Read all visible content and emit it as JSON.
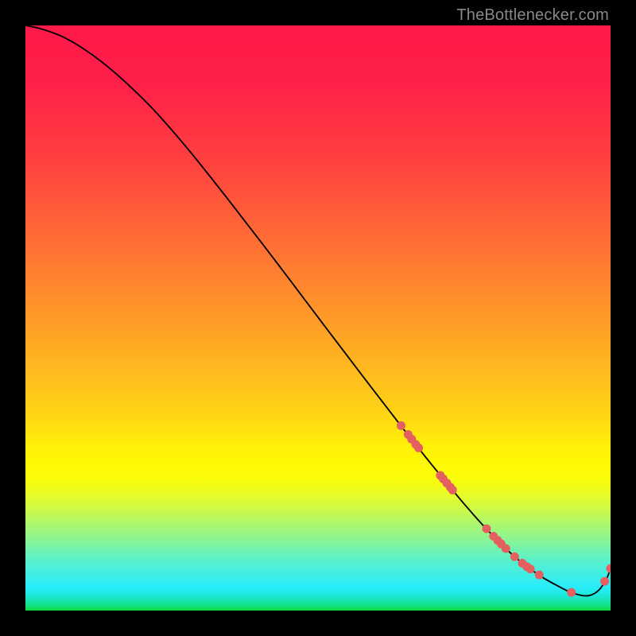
{
  "signature": "TheBottlenecker.com",
  "chart_data": {
    "type": "line",
    "xlabel": "",
    "ylabel": "",
    "xlim": [
      0,
      100
    ],
    "ylim": [
      0,
      100
    ],
    "gradient_stops": [
      {
        "pct": 0,
        "color": "#ff1a49"
      },
      {
        "pct": 9,
        "color": "#ff1e49"
      },
      {
        "pct": 24,
        "color": "#ff433f"
      },
      {
        "pct": 39,
        "color": "#ff7433"
      },
      {
        "pct": 54,
        "color": "#ffa824"
      },
      {
        "pct": 66,
        "color": "#ffd316"
      },
      {
        "pct": 72,
        "color": "#fff108"
      },
      {
        "pct": 76,
        "color": "#fffb04"
      },
      {
        "pct": 78.5,
        "color": "#f5fc13"
      },
      {
        "pct": 82,
        "color": "#d5fa3e"
      },
      {
        "pct": 88,
        "color": "#89f497"
      },
      {
        "pct": 92,
        "color": "#53f0d3"
      },
      {
        "pct": 96,
        "color": "#28ecf9"
      },
      {
        "pct": 97.5,
        "color": "#1be8d9"
      },
      {
        "pct": 99,
        "color": "#13e18b"
      },
      {
        "pct": 100,
        "color": "#0fda41"
      }
    ],
    "series": [
      {
        "name": "curve",
        "color": "#000000",
        "show_markers": false,
        "x": [
          0.0,
          2.0,
          4.0,
          6.5,
          9.5,
          13.0,
          17.0,
          22.0,
          28.0,
          35.0,
          43.0,
          51.0,
          58.0,
          64.0,
          68.5,
          72.0,
          75.0,
          78.0,
          81.0,
          83.5,
          86.0,
          88.5,
          91.0,
          93.0,
          95.0,
          96.5,
          98.0,
          99.3,
          100.0
        ],
        "y": [
          100.0,
          99.6,
          99.0,
          98.0,
          96.3,
          93.8,
          90.4,
          85.5,
          78.6,
          69.8,
          59.4,
          48.8,
          39.6,
          31.8,
          26.1,
          21.8,
          18.2,
          14.8,
          11.7,
          9.3,
          7.3,
          5.6,
          4.2,
          3.2,
          2.6,
          2.6,
          3.5,
          5.4,
          7.2
        ]
      },
      {
        "name": "markers",
        "color": "#e46060",
        "show_markers": true,
        "marker_radius_px": 5.5,
        "x": [
          64.2,
          65.4,
          66.0,
          66.7,
          67.2,
          70.9,
          71.4,
          72.0,
          72.6,
          73.0,
          78.8,
          80.0,
          80.7,
          81.3,
          82.1,
          83.6,
          84.9,
          85.7,
          86.3,
          87.8,
          93.3,
          99.0,
          100.0
        ],
        "y": [
          31.6,
          30.1,
          29.3,
          28.4,
          27.8,
          23.1,
          22.5,
          21.8,
          21.1,
          20.6,
          14.0,
          12.7,
          12.0,
          11.4,
          10.6,
          9.2,
          8.1,
          7.5,
          7.1,
          6.1,
          3.1,
          5.0,
          7.2
        ]
      }
    ]
  }
}
